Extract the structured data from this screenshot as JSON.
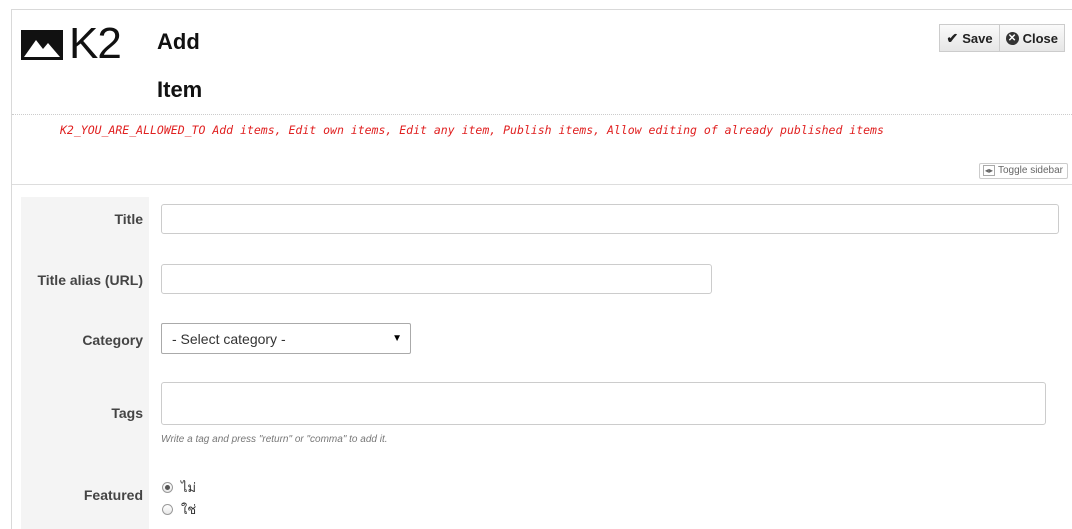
{
  "header": {
    "logo_text": "K2",
    "title_line1": "Add",
    "title_line2": "Item"
  },
  "toolbar": {
    "save_label": "Save",
    "close_label": "Close",
    "save_icon": "checkmark-icon",
    "close_icon": "close-circle-icon"
  },
  "permissions_message": "K2_YOU_ARE_ALLOWED_TO Add items, Edit own items, Edit any item, Publish items, Allow editing of already published items",
  "toggle_sidebar_label": "Toggle sidebar",
  "form": {
    "title_label": "Title",
    "title_value": "",
    "alias_label": "Title alias (URL)",
    "alias_value": "",
    "category_label": "Category",
    "category_selected": "- Select category -",
    "tags_label": "Tags",
    "tags_value": "",
    "tags_help": "Write a tag and press \"return\" or \"comma\" to add it.",
    "featured_label": "Featured",
    "featured_options": [
      {
        "label": "ไม่",
        "checked": true
      },
      {
        "label": "ใช่",
        "checked": false
      }
    ]
  },
  "colors": {
    "permission_text": "#e02020",
    "label_column_bg": "#f4f4f4"
  }
}
